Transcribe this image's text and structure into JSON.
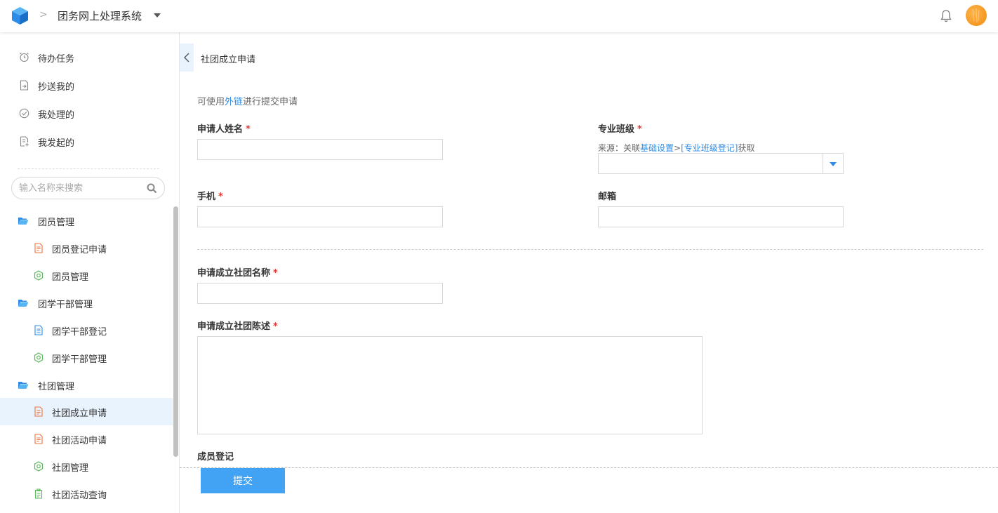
{
  "header": {
    "logo_icon": "cube-logo-icon",
    "separator": ">",
    "app_title": "团务网上处理系统",
    "accent_color": "#2d8ce8"
  },
  "sidebar": {
    "quick_items": [
      {
        "label": "待办任务",
        "icon": "alarm-clock-icon"
      },
      {
        "label": "抄送我的",
        "icon": "document-export-icon"
      },
      {
        "label": "我处理的",
        "icon": "check-circle-icon"
      },
      {
        "label": "我发起的",
        "icon": "document-plus-icon"
      }
    ],
    "search_placeholder": "输入名称来搜索",
    "tree": [
      {
        "label": "团员管理",
        "type": "folder",
        "icon": "folder-open-icon"
      },
      {
        "label": "团员登记申请",
        "type": "leaf",
        "icon": "form-doc-icon",
        "color": "#f0713a"
      },
      {
        "label": "团员管理",
        "type": "leaf",
        "icon": "gear-hex-icon",
        "color": "#5cb85c"
      },
      {
        "label": "团学干部管理",
        "type": "folder",
        "icon": "folder-open-icon"
      },
      {
        "label": "团学干部登记",
        "type": "leaf",
        "icon": "doc-icon",
        "color": "#2d8ce8"
      },
      {
        "label": "团学干部管理",
        "type": "leaf",
        "icon": "gear-hex-icon",
        "color": "#5cb85c"
      },
      {
        "label": "社团管理",
        "type": "folder",
        "icon": "folder-open-icon"
      },
      {
        "label": "社团成立申请",
        "type": "leaf",
        "icon": "form-doc-icon",
        "color": "#f0713a",
        "active": true
      },
      {
        "label": "社团活动申请",
        "type": "leaf",
        "icon": "form-doc-icon",
        "color": "#f0713a"
      },
      {
        "label": "社团管理",
        "type": "leaf",
        "icon": "gear-hex-icon",
        "color": "#5cb85c"
      },
      {
        "label": "社团活动查询",
        "type": "leaf",
        "icon": "clipboard-icon",
        "color": "#5cb85c"
      }
    ]
  },
  "main": {
    "page_title": "社团成立申请",
    "hint_prefix": "可使用",
    "hint_link": "外链",
    "hint_suffix": "进行提交申请",
    "fields": {
      "applicant_name": {
        "label": "申请人姓名",
        "required": "*"
      },
      "major_class": {
        "label": "专业班级",
        "required": "*",
        "note_prefix": "来源：关联",
        "note_link1": "基础设置",
        "note_sep": ">",
        "note_link2": "[专业班级登记]",
        "note_suffix": "获取"
      },
      "phone": {
        "label": "手机",
        "required": "*"
      },
      "email": {
        "label": "邮箱"
      },
      "club_name": {
        "label": "申请成立社团名称",
        "required": "*"
      },
      "club_description": {
        "label": "申请成立社团陈述",
        "required": "*"
      },
      "member_registration": {
        "label": "成员登记"
      }
    },
    "submit_label": "提交",
    "submit_color": "#42a3f5"
  }
}
